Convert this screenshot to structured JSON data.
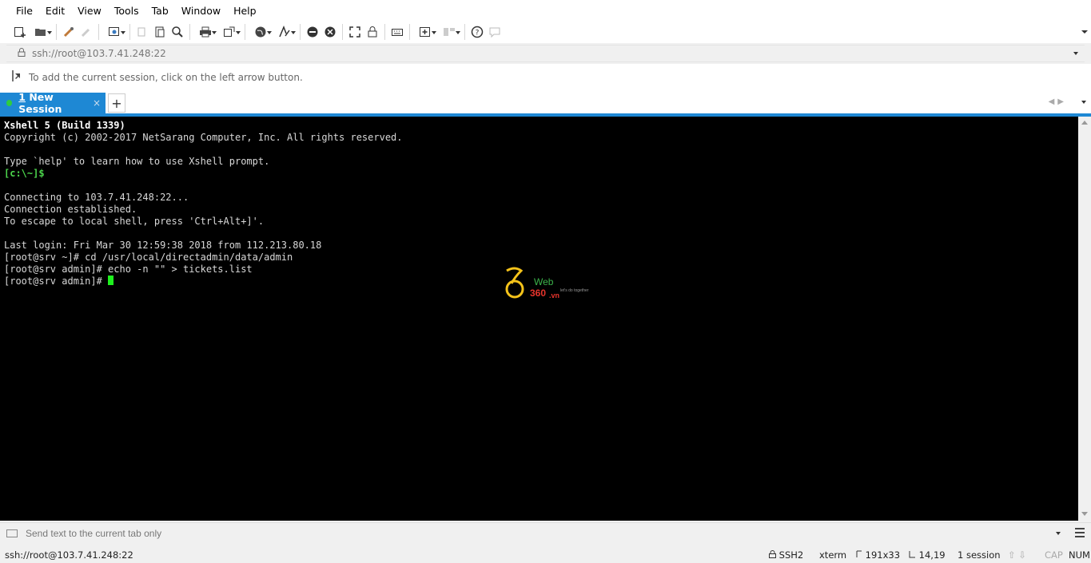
{
  "menu": [
    "File",
    "Edit",
    "View",
    "Tools",
    "Tab",
    "Window",
    "Help"
  ],
  "address": {
    "url": "ssh://root@103.7.41.248:22"
  },
  "hint": {
    "text": "To add the current session, click on the left arrow button."
  },
  "tab": {
    "number": "1",
    "label": " New Session",
    "close": "×",
    "add": "+"
  },
  "terminal": {
    "lines": [
      "Xshell 5 (Build 1339)",
      "Copyright (c) 2002-2017 NetSarang Computer, Inc. All rights reserved.",
      "",
      "Type `help' to learn how to use Xshell prompt.",
      "[c:\\~]$",
      "",
      "Connecting to 103.7.41.248:22...",
      "Connection established.",
      "To escape to local shell, press 'Ctrl+Alt+]'.",
      "",
      "Last login: Fri Mar 30 12:59:38 2018 from 112.213.80.18",
      "[root@srv ~]# cd /usr/local/directadmin/data/admin",
      "[root@srv admin]# echo -n \"\" > tickets.list",
      "[root@srv admin]# "
    ]
  },
  "watermark": {
    "brand_top": "Web",
    "brand_bottom": "360",
    "suffix": ".vn",
    "tagline": "let's do together"
  },
  "sendbar": {
    "placeholder": "Send text to the current tab only"
  },
  "status": {
    "connection": "ssh://root@103.7.41.248:22",
    "protocol": "SSH2",
    "terminal": "xterm",
    "size": "191x33",
    "position": "14,19",
    "sessions": "1 session",
    "cap": "CAP",
    "num": "NUM"
  },
  "colors": {
    "accent": "#1e88d4",
    "cursor": "#1ef01e",
    "terminal_bg": "#000000"
  }
}
